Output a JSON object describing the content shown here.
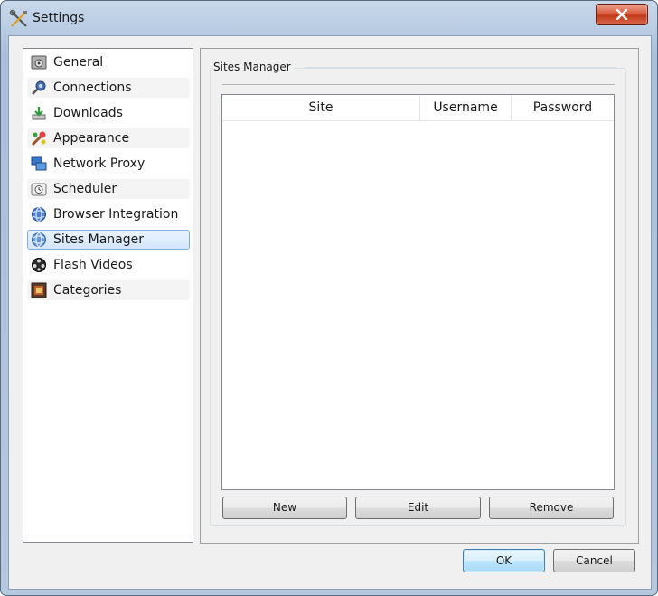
{
  "window": {
    "title": "Settings"
  },
  "sidebar": {
    "items": [
      {
        "label": "General",
        "icon": "general-icon"
      },
      {
        "label": "Connections",
        "icon": "connections-icon"
      },
      {
        "label": "Downloads",
        "icon": "downloads-icon"
      },
      {
        "label": "Appearance",
        "icon": "appearance-icon"
      },
      {
        "label": "Network Proxy",
        "icon": "network-proxy-icon"
      },
      {
        "label": "Scheduler",
        "icon": "scheduler-icon"
      },
      {
        "label": "Browser Integration",
        "icon": "browser-integration-icon"
      },
      {
        "label": "Sites Manager",
        "icon": "sites-manager-icon"
      },
      {
        "label": "Flash Videos",
        "icon": "flash-videos-icon"
      },
      {
        "label": "Categories",
        "icon": "categories-icon"
      }
    ],
    "selected": "Sites Manager"
  },
  "panel": {
    "group_title": "Sites Manager",
    "table": {
      "columns": [
        "Site",
        "Username",
        "Password"
      ],
      "rows": []
    },
    "buttons": {
      "new": "New",
      "edit": "Edit",
      "remove": "Remove"
    }
  },
  "footer": {
    "ok": "OK",
    "cancel": "Cancel"
  },
  "colors": {
    "selection": "#d3e6fb",
    "selection_border": "#84acdd",
    "close": "#c23b1a",
    "titlebar": "#b9cde4"
  }
}
